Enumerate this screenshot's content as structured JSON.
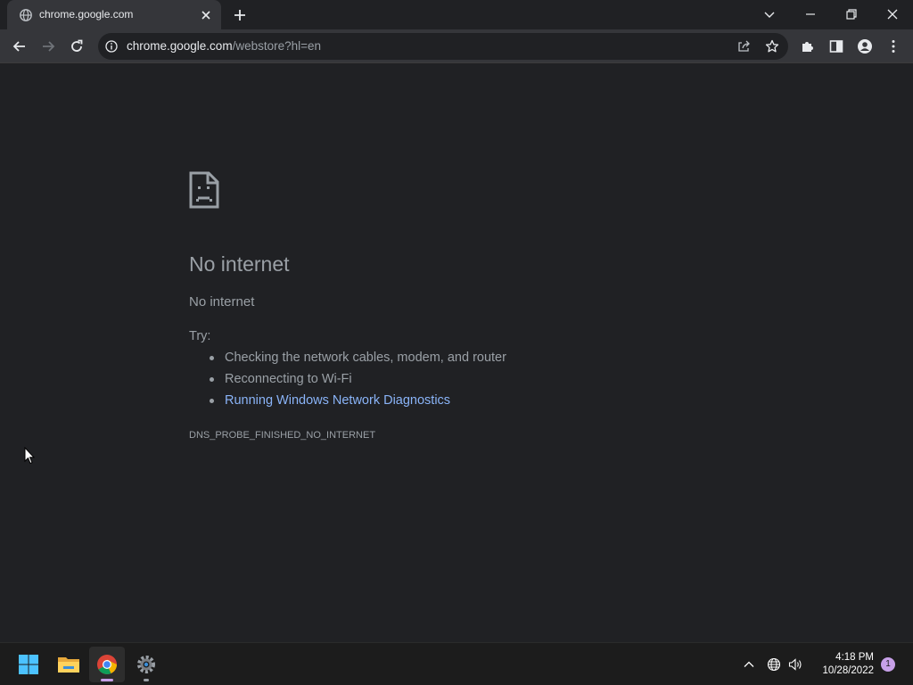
{
  "browser": {
    "tab": {
      "title": "chrome.google.com",
      "favicon": "globe-icon"
    },
    "address": {
      "host": "chrome.google.com",
      "path": "/webstore?hl=en"
    }
  },
  "error_page": {
    "title": "No internet",
    "subtitle": "No internet",
    "try_label": "Try:",
    "suggestions": [
      "Checking the network cables, modem, and router",
      "Reconnecting to Wi-Fi",
      "Running Windows Network Diagnostics"
    ],
    "error_code": "DNS_PROBE_FINISHED_NO_INTERNET"
  },
  "taskbar": {
    "apps": [
      "windows-start-icon",
      "file-explorer-icon",
      "chrome-icon",
      "settings-icon"
    ],
    "clock": {
      "time": "4:18 PM",
      "date": "10/28/2022"
    },
    "notification_count": "1"
  },
  "colors": {
    "background": "#202124",
    "toolbar": "#35363a",
    "link": "#8ab4f8",
    "text_muted": "#9aa0a6",
    "accent": "#c7a0e8"
  }
}
